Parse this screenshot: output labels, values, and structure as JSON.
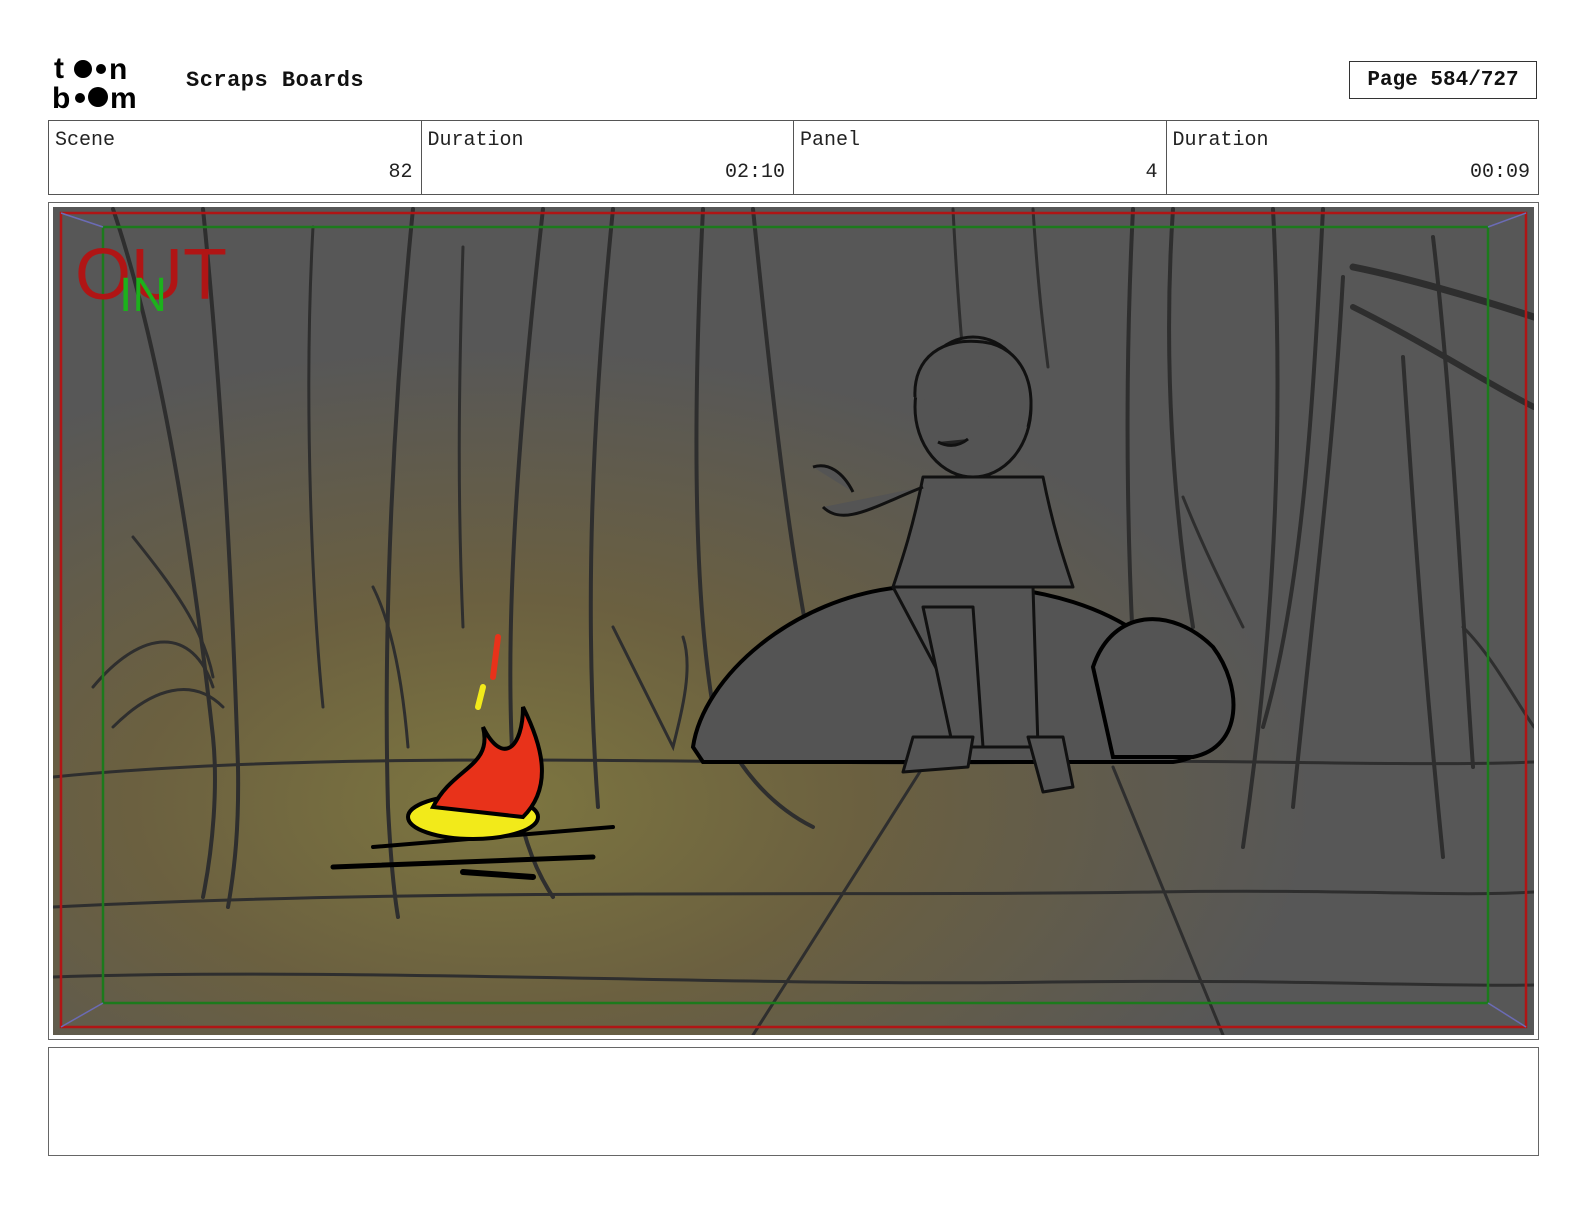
{
  "header": {
    "logo_icon": "toon-boom-logo-icon",
    "project_title": "Scraps Boards",
    "page_label": "Page 584/727"
  },
  "info": {
    "scene_label": "Scene",
    "scene_value": "82",
    "scene_duration_label": "Duration",
    "scene_duration_value": "02:10",
    "panel_label": "Panel",
    "panel_value": "4",
    "panel_duration_label": "Duration",
    "panel_duration_value": "00:09"
  },
  "panel": {
    "out_marker": "OUT",
    "in_marker": "IN",
    "colors": {
      "out_frame": "#b01515",
      "in_frame": "#1c7a1c",
      "fire_red": "#e8321a",
      "fire_yellow": "#f2ea1a",
      "background": "#5a5a5a"
    }
  },
  "notes": {}
}
